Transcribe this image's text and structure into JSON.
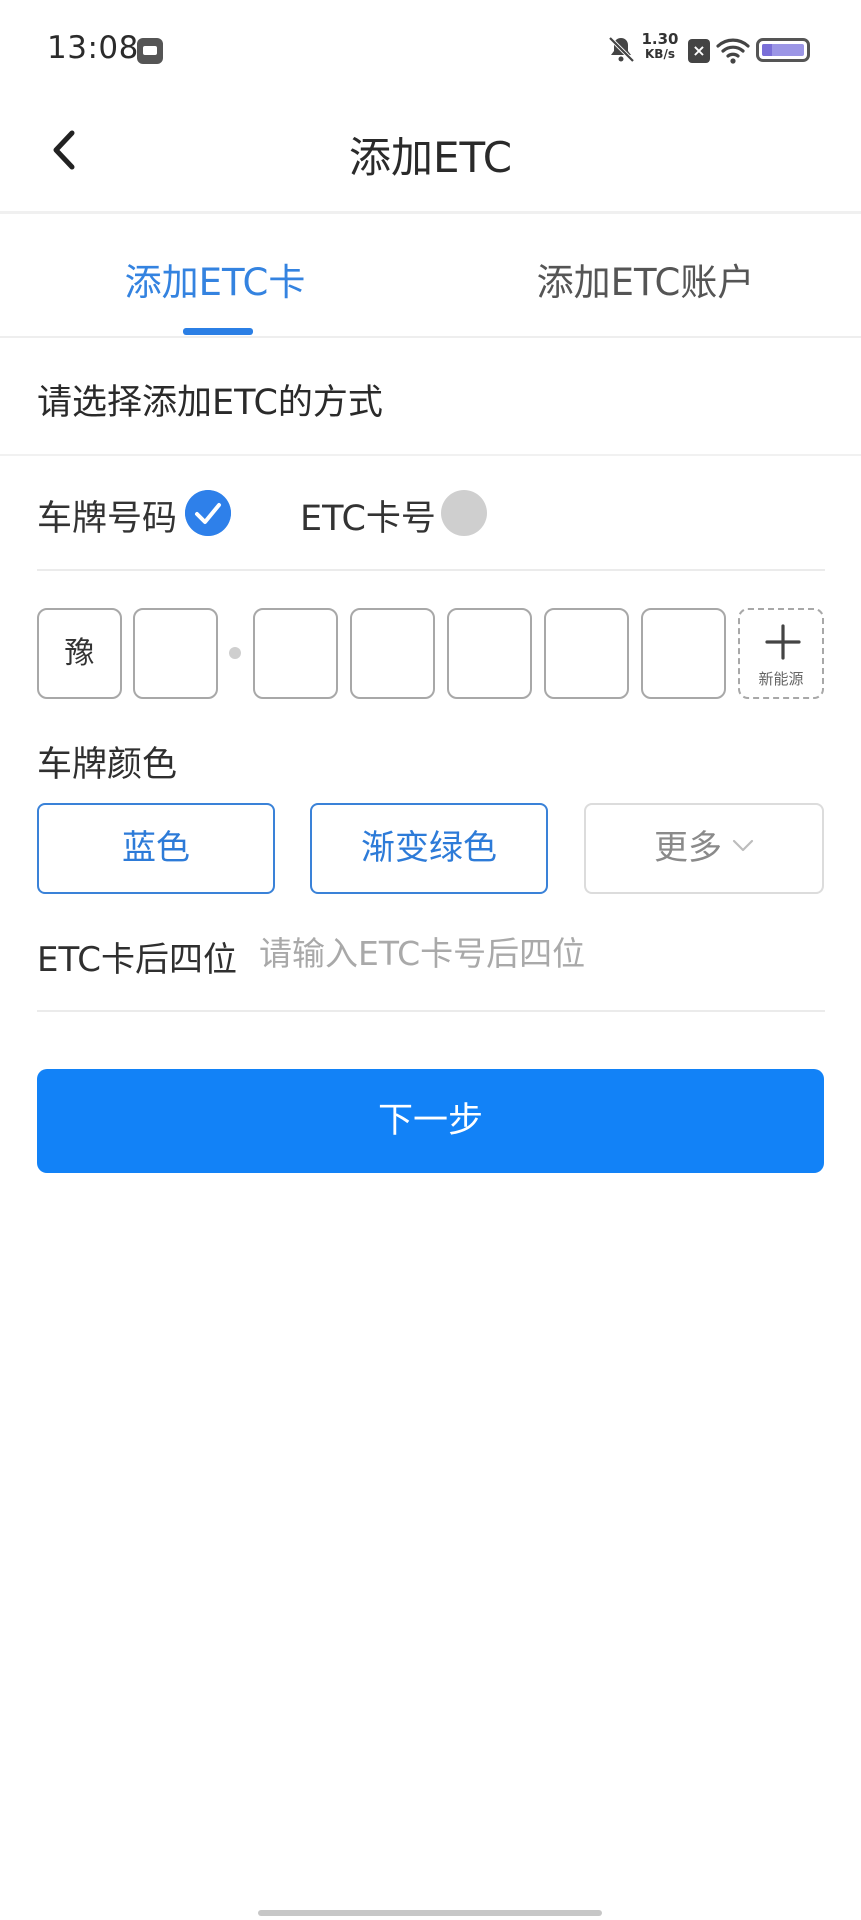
{
  "status_bar": {
    "time": "13:08",
    "net_speed_value": "1.30",
    "net_speed_unit": "KB/s",
    "icons": [
      "app-notification-icon",
      "bell-muted-icon",
      "data-off-icon",
      "wifi-icon",
      "battery-icon"
    ]
  },
  "nav": {
    "title": "添加ETC",
    "back_icon": "chevron-left-icon"
  },
  "tabs": [
    {
      "label": "添加ETC卡",
      "active": true
    },
    {
      "label": "添加ETC账户",
      "active": false
    }
  ],
  "section": {
    "title": "请选择添加ETC的方式"
  },
  "method": {
    "options": [
      {
        "label": "车牌号码",
        "selected": true
      },
      {
        "label": "ETC卡号",
        "selected": false
      }
    ]
  },
  "plate": {
    "province": "豫",
    "chars": [
      "",
      "",
      "",
      "",
      "",
      ""
    ],
    "new_energy_label": "新能源"
  },
  "plate_color": {
    "label": "车牌颜色",
    "options": [
      "蓝色",
      "渐变绿色"
    ],
    "more_label": "更多"
  },
  "card_last4": {
    "label": "ETC卡后四位",
    "placeholder": "请输入ETC卡号后四位",
    "value": ""
  },
  "next_button": {
    "label": "下一步"
  },
  "colors": {
    "accent": "#1282f7",
    "tab_active": "#3483e0",
    "radio_on": "#2e80ea",
    "radio_off": "#cfcfcf"
  }
}
